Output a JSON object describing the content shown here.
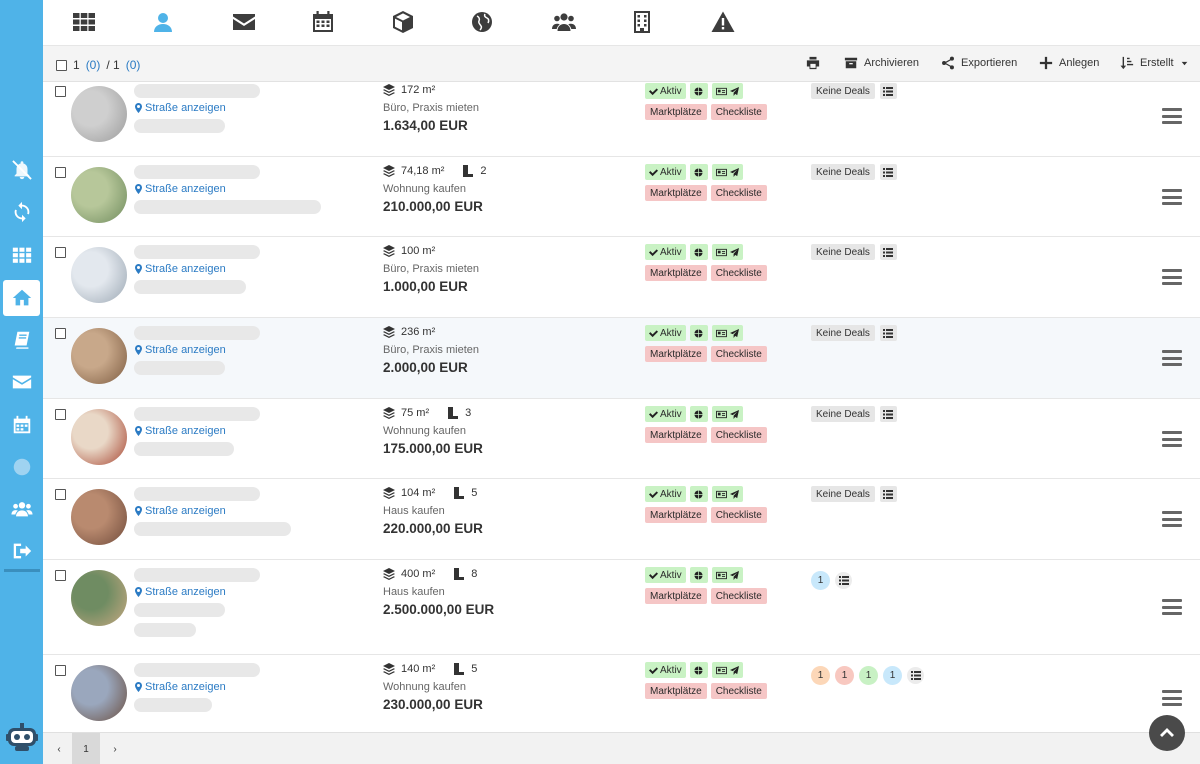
{
  "topnav": {
    "items": [
      {
        "icon": "grid-icon"
      },
      {
        "icon": "user-icon",
        "active": true
      },
      {
        "icon": "envelope-icon"
      },
      {
        "icon": "calendar-icon"
      },
      {
        "icon": "cube-icon"
      },
      {
        "icon": "globe-icon"
      },
      {
        "icon": "users-icon"
      },
      {
        "icon": "building-icon"
      },
      {
        "icon": "warning-icon"
      }
    ]
  },
  "sidebar": {
    "items": [
      {
        "icon": "bell-slash-icon"
      },
      {
        "icon": "refresh-icon"
      },
      {
        "icon": "grid-icon"
      },
      {
        "icon": "home-icon",
        "active": true
      },
      {
        "icon": "book-icon"
      },
      {
        "icon": "envelope-icon"
      },
      {
        "icon": "calendar-icon"
      },
      {
        "icon": "globe-icon",
        "dim": true
      },
      {
        "icon": "users-icon"
      },
      {
        "icon": "sign-out-icon"
      }
    ],
    "bottom_icon": "robot-icon"
  },
  "toolbar": {
    "selection_count": "1",
    "selection_selected": "(0)",
    "selection_sep": "/ 1",
    "selection_total_selected": "(0)",
    "print_icon": "print-icon",
    "archive_label": "Archivieren",
    "export_label": "Exportieren",
    "create_label": "Anlegen",
    "sort_label": "Erstellt"
  },
  "listings": [
    {
      "area": "172 m²",
      "rooms": "",
      "type": "Büro, Praxis mieten",
      "price": "1.634,00 EUR",
      "location_label": "Straße anzeigen",
      "deals_label": "Keine Deals",
      "deals": []
    },
    {
      "area": "74,18 m²",
      "rooms": "2",
      "type": "Wohnung kaufen",
      "price": "210.000,00 EUR",
      "location_label": "Straße anzeigen",
      "deals_label": "Keine Deals",
      "deals": []
    },
    {
      "area": "100 m²",
      "rooms": "",
      "type": "Büro, Praxis mieten",
      "price": "1.000,00 EUR",
      "location_label": "Straße anzeigen",
      "deals_label": "Keine Deals",
      "deals": []
    },
    {
      "area": "236 m²",
      "rooms": "",
      "type": "Büro, Praxis mieten",
      "price": "2.000,00 EUR",
      "location_label": "Straße anzeigen",
      "deals_label": "Keine Deals",
      "deals": []
    },
    {
      "area": "75 m²",
      "rooms": "3",
      "type": "Wohnung kaufen",
      "price": "175.000,00 EUR",
      "location_label": "Straße anzeigen",
      "deals_label": "Keine Deals",
      "deals": []
    },
    {
      "area": "104 m²",
      "rooms": "5",
      "type": "Haus kaufen",
      "price": "220.000,00 EUR",
      "location_label": "Straße anzeigen",
      "deals_label": "Keine Deals",
      "deals": []
    },
    {
      "area": "400 m²",
      "rooms": "8",
      "type": "Haus kaufen",
      "price": "2.500.000,00 EUR",
      "location_label": "Straße anzeigen",
      "deals_label": "",
      "deals": [
        {
          "count": "1",
          "color": "#c8e8fb"
        }
      ]
    },
    {
      "area": "140 m²",
      "rooms": "5",
      "type": "Wohnung kaufen",
      "price": "230.000,00 EUR",
      "location_label": "Straße anzeigen",
      "deals_label": "",
      "deals": [
        {
          "count": "1",
          "color": "#fcd7b8"
        },
        {
          "count": "1",
          "color": "#f8c8c0"
        },
        {
          "count": "1",
          "color": "#c8f1c4"
        },
        {
          "count": "1",
          "color": "#c8e8fb"
        }
      ]
    }
  ],
  "badges": {
    "active_label": "Aktiv",
    "marketplaces_label": "Marktplätze",
    "checklist_label": "Checkliste"
  },
  "pager": {
    "prev": "‹",
    "current_page": "1",
    "next": "›"
  },
  "colors": {
    "sidebar": "#4fb3e8",
    "link": "#2b7bc4",
    "badge_green": "#c9f2c4",
    "badge_red": "#f5c6c6"
  }
}
